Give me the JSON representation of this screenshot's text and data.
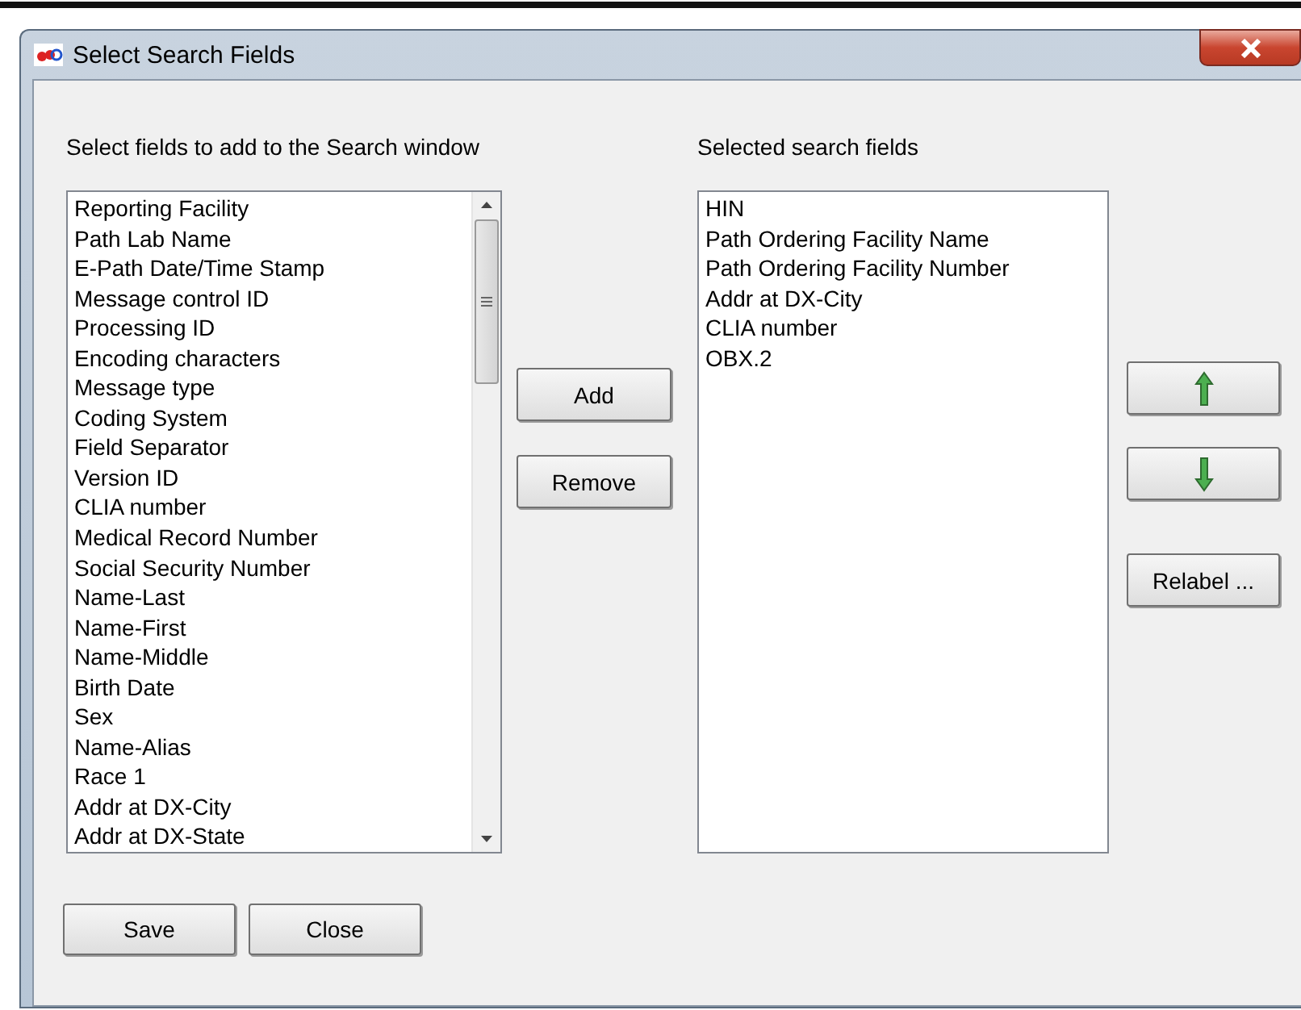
{
  "window": {
    "title": "Select Search Fields"
  },
  "available": {
    "label": "Select fields to add to the Search window",
    "items": [
      "Reporting Facility",
      "Path Lab Name",
      "E-Path Date/Time Stamp",
      "Message control ID",
      "Processing ID",
      "Encoding characters",
      "Message type",
      "Coding System",
      "Field Separator",
      "Version ID",
      "CLIA number",
      "Medical Record Number",
      "Social Security Number",
      "Name-Last",
      "Name-First",
      "Name-Middle",
      "Birth Date",
      "Sex",
      "Name-Alias",
      "Race 1",
      "Addr at DX-City",
      "Addr at DX-State"
    ]
  },
  "transfer_buttons": [
    "Add",
    "Remove"
  ],
  "selected": {
    "label": "Selected search fields",
    "items": [
      "HIN",
      "Path Ordering Facility Name",
      "Path Ordering Facility Number",
      "Addr at DX-City",
      "CLIA number",
      "OBX.2"
    ]
  },
  "order_buttons": [
    {
      "kind": "up"
    },
    {
      "kind": "down"
    },
    {
      "kind": "text",
      "label": "Relabel ..."
    }
  ],
  "footer_buttons": [
    "Save",
    "Close"
  ]
}
